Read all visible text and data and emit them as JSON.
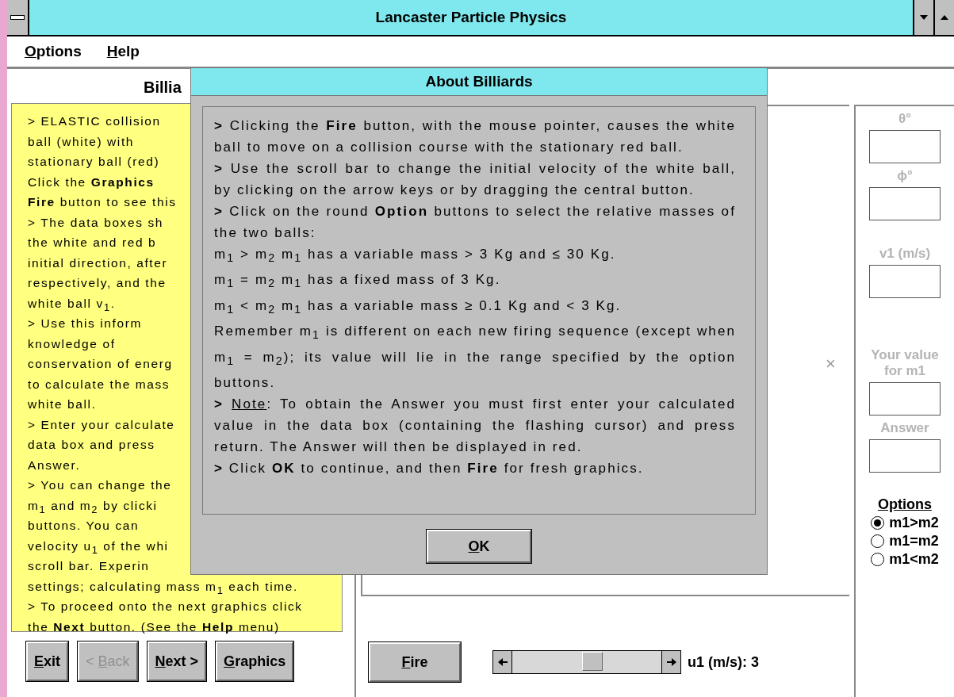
{
  "window": {
    "title": "Lancaster Particle Physics"
  },
  "menu": [
    {
      "key": "O",
      "rest": "ptions"
    },
    {
      "key": "H",
      "rest": "elp"
    }
  ],
  "panel": {
    "heading": "Billia",
    "lines": [
      "> ELASTIC collision",
      "ball (white) with",
      "stationary ball (red)",
      "Click the **Graphics**",
      "**Fire** button to see this",
      "> The data boxes sh",
      "the white and red b",
      "initial direction, after",
      "respectively, and the",
      "white ball v$_{1}$.",
      "> Use this inform",
      "knowledge of",
      "conservation of energ",
      "to calculate the mass",
      "white ball.",
      "> Enter your calculate",
      "data box and press",
      "Answer.",
      "> You can change the",
      "m$_{1}$ and m$_{2}$ by clicki",
      "buttons. You can",
      "velocity u$_{1}$ of the whi",
      "scroll bar. Experin",
      "settings; calculating mass m$_{1}$ each time.",
      "> To proceed onto the next graphics click",
      "the **Next** button. (See the **Help** menu)"
    ]
  },
  "buttons": [
    {
      "key": "E",
      "rest": "xit",
      "disabled": false
    },
    {
      "pre": "< ",
      "key": "B",
      "rest": "ack",
      "disabled": true
    },
    {
      "key": "N",
      "rest": "ext >",
      "disabled": false
    },
    {
      "key": "G",
      "rest": "raphics",
      "disabled": false
    }
  ],
  "graphics": {
    "marker": "×"
  },
  "fire_button": {
    "key": "F",
    "rest": "ire"
  },
  "velocity": {
    "reading": "u1 (m/s): 3"
  },
  "data_fields": [
    {
      "label": "θ°",
      "disabled": true
    },
    {
      "label": "ϕ°",
      "disabled": true
    },
    {
      "label": "v1 (m/s)",
      "disabled": true
    },
    {
      "label": "Your value for m1",
      "disabled": true
    },
    {
      "label": "Answer",
      "disabled": true
    }
  ],
  "options": {
    "title": "Options",
    "items": [
      {
        "label": "m1>m2",
        "selected": true
      },
      {
        "label": "m1=m2",
        "selected": false
      },
      {
        "label": "m1<m2",
        "selected": false
      }
    ]
  },
  "dialog": {
    "title": "About Billiards",
    "paragraphs": [
      {
        "kind": "text",
        "text": "**>** Clicking the **Fire** button, with the mouse pointer, causes the white ball to move on a collision course with the stationary red ball."
      },
      {
        "kind": "text",
        "text": "**>** Use the scroll bar to change the initial velocity of the white ball, by clicking on the arrow keys or by dragging the central button."
      },
      {
        "kind": "text",
        "text": "**>** Click on the round **Option** buttons to select the relative masses of the two balls:"
      },
      {
        "kind": "text",
        "text": "m$_{1}$ > m$_{2}$ m$_{1}$ has a variable mass > 3 Kg and ≤ 30 Kg."
      },
      {
        "kind": "text",
        "text": "m$_{1}$ = m$_{2}$ m$_{1}$ has a fixed mass of 3 Kg."
      },
      {
        "kind": "text",
        "text": "m$_{1}$ < m$_{2}$ m$_{1}$ has a variable mass ≥ 0.1 Kg and < 3 Kg."
      },
      {
        "kind": "text",
        "text": "Remember m$_{1}$ is different on each new firing sequence (except when m$_{1}$ = m$_{2}$); its value will lie in the range specified by the option buttons."
      },
      {
        "kind": "note",
        "lead": ">",
        "label": "Note",
        "text": ":  To obtain the Answer you must first enter your calculated value in the data box (containing the flashing cursor) and press return.  The Answer will then be displayed in red."
      },
      {
        "kind": "text",
        "text": "**>** Click **OK** to continue, and then **Fire** for fresh graphics."
      }
    ],
    "ok": {
      "key": "O",
      "rest": "K"
    }
  }
}
